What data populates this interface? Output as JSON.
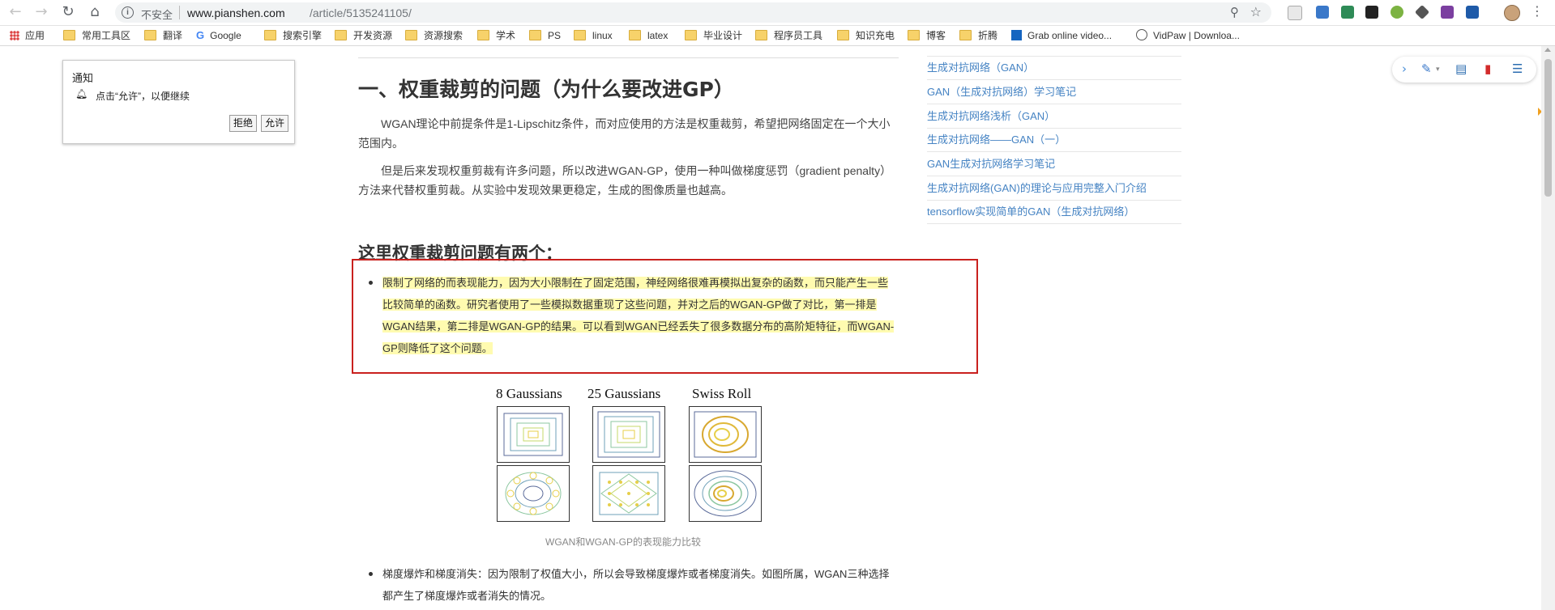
{
  "browser": {
    "security_label": "不安全",
    "url_host": "www.pianshen.com",
    "url_path": "/article/5135241105/",
    "bookmarks": [
      {
        "label": "应用",
        "icon": "apps-grid-icon"
      },
      {
        "label": "常用工具区",
        "icon": "folder-icon"
      },
      {
        "label": "翻译",
        "icon": "folder-icon"
      },
      {
        "label": "Google",
        "icon": "google-icon"
      },
      {
        "label": "搜索引擎",
        "icon": "folder-icon"
      },
      {
        "label": "开发资源",
        "icon": "folder-icon"
      },
      {
        "label": "资源搜索",
        "icon": "folder-icon"
      },
      {
        "label": "学术",
        "icon": "folder-icon"
      },
      {
        "label": "PS",
        "icon": "folder-icon"
      },
      {
        "label": "linux",
        "icon": "folder-icon"
      },
      {
        "label": "latex",
        "icon": "folder-icon"
      },
      {
        "label": "毕业设计",
        "icon": "folder-icon"
      },
      {
        "label": "程序员工具",
        "icon": "folder-icon"
      },
      {
        "label": "知识充电",
        "icon": "folder-icon"
      },
      {
        "label": "博客",
        "icon": "folder-icon"
      },
      {
        "label": "折腾",
        "icon": "folder-icon"
      },
      {
        "label": "Grab online video...",
        "icon": "grab-icon"
      },
      {
        "label": "VidPaw | Downloa...",
        "icon": "vidpaw-icon"
      }
    ]
  },
  "notification": {
    "title": "通知",
    "message": "点击“允许”，以便继续",
    "deny_label": "拒绝",
    "allow_label": "允许"
  },
  "article": {
    "heading": "一、权重裁剪的问题（为什么要改进GP）",
    "para1": "WGAN理论中前提条件是1-Lipschitz条件，而对应使用的方法是权重裁剪，希望把网络固定在一个大小范围内。",
    "para2": "但是后来发现权重剪裁有许多问题，所以改进WGAN-GP，使用一种叫做梯度惩罚（gradient penalty）方法来代替权重剪裁。从实验中发现效果更稳定，生成的图像质量也越高。",
    "subheading": "这里权重裁剪问题有两个：",
    "bullet1": "限制了网络的而表现能力，因为大小限制在了固定范围，神经网络很难再模拟出复杂的函数，而只能产生一些比较简单的函数。研究者使用了一些模拟数据重现了这些问题，并对之后的WGAN-GP做了对比，第一排是WGAN结果，第二排是WGAN-GP的结果。可以看到WGAN已经丢失了很多数据分布的高阶矩特征，而WGAN-GP则降低了这个问题。",
    "figure_titles": [
      "8 Gaussians",
      "25 Gaussians",
      "Swiss Roll"
    ],
    "caption": "WGAN和WGAN-GP的表现能力比较",
    "bullet2": "梯度爆炸和梯度消失：因为限制了权值大小，所以会导致梯度爆炸或者梯度消失。如图所属，WGAN三种选择都产生了梯度爆炸或者消失的情况。"
  },
  "sidebar": {
    "links": [
      "生成对抗网络（GAN）",
      "GAN（生成对抗网络）学习笔记",
      "生成对抗网络浅析（GAN）",
      "生成对抗网络——GAN（一）",
      "GAN生成对抗网络学习笔记",
      "生成对抗网络(GAN)的理论与应用完整入门介绍",
      "tensorflow实现简单的GAN（生成对抗网络）"
    ]
  },
  "colors": {
    "highlight": "#fffbb0",
    "red_box": "#c9211e",
    "link": "#4583c3"
  }
}
